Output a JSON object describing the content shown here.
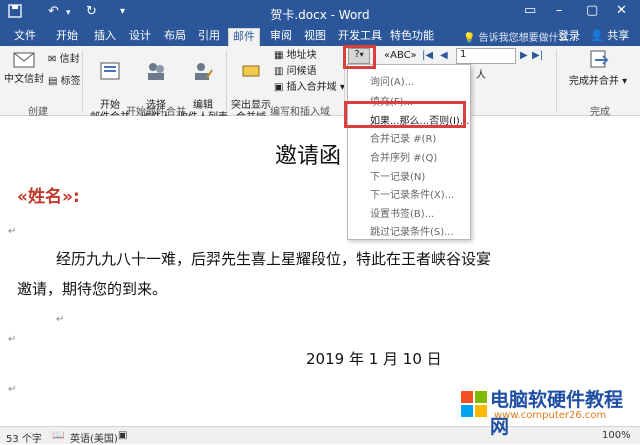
{
  "window": {
    "title": "贺卡.docx - Word",
    "quick_access": [
      "save-icon",
      "undo-icon",
      "redo-icon",
      "customize-icon"
    ],
    "controls": [
      "ribbon-display-icon",
      "minimize-icon",
      "maximize-icon",
      "close-icon"
    ]
  },
  "tabs": [
    "文件",
    "开始",
    "插入",
    "设计",
    "布局",
    "引用",
    "邮件",
    "审阅",
    "视图",
    "开发工具",
    "特色功能"
  ],
  "active_tab": "邮件",
  "tellme": "告诉我您想要做什么...",
  "login": "登录",
  "share": "共享",
  "ribbon": {
    "create": {
      "envelope": "中文信封",
      "envelope2": "信封",
      "label": "标签",
      "group": "创建"
    },
    "start_merge": {
      "start": "开始\n邮件合并",
      "select": "选择\n收件人",
      "edit": "编辑\n收件人列表",
      "group": "开始邮件合并"
    },
    "write_insert": {
      "highlight": "突出显示\n合并域",
      "address": "地址块",
      "greeting": "问候语",
      "insert_field": "插入合并域",
      "rules": "规则",
      "preview": "预览结果",
      "group": "编写和插入域"
    },
    "preview": {
      "record_num": "1",
      "recipient": "人"
    },
    "finish": {
      "finish": "完成并合并",
      "group": "完成"
    }
  },
  "rules_menu": {
    "items": [
      {
        "label": "询问(A)...",
        "enabled": false
      },
      {
        "label": "填充(F)...",
        "enabled": false
      },
      {
        "label": "如果...那么...否则(I)...",
        "enabled": true
      },
      {
        "label": "合并记录 #(R)",
        "enabled": false
      },
      {
        "label": "合并序列 #(Q)",
        "enabled": false
      },
      {
        "label": "下一记录(N)",
        "enabled": false
      },
      {
        "label": "下一记录条件(X)...",
        "enabled": false
      },
      {
        "label": "设置书签(B)...",
        "enabled": false
      },
      {
        "label": "跳过记录条件(S)...",
        "enabled": false
      }
    ]
  },
  "document": {
    "heading": "邀请函",
    "merge_field": "«姓名»:",
    "paragraph1": "经历九九八十一难，后羿先生喜上星耀段位，特此在王者峡谷设宴",
    "paragraph2": "邀请，期待您的到来。",
    "date": "2019 年 1 月 10 日"
  },
  "statusbar": {
    "words": "53 个字",
    "language": "英语(美国)",
    "zoom": "100%"
  },
  "watermark": {
    "title": "电脑软硬件教程网",
    "url": "www.computer26.com"
  }
}
